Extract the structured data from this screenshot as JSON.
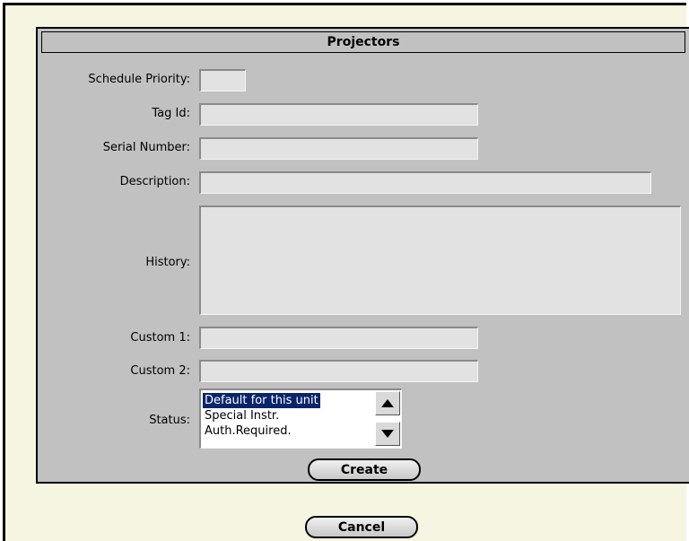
{
  "form": {
    "title": "Projectors",
    "labels": {
      "schedule_priority": "Schedule Priority:",
      "tag_id": "Tag Id:",
      "serial_number": "Serial Number:",
      "description": "Description:",
      "history": "History:",
      "custom1": "Custom 1:",
      "custom2": "Custom 2:",
      "status": "Status:"
    },
    "values": {
      "schedule_priority": "",
      "tag_id": "",
      "serial_number": "",
      "description": "",
      "history": "",
      "custom1": "",
      "custom2": ""
    },
    "status_options": [
      "Default for this unit",
      "Special Instr.",
      "Auth.Required."
    ],
    "status_selected": "Default for this unit",
    "create_label": "Create"
  },
  "footer": {
    "cancel_label": "Cancel"
  },
  "colors": {
    "page_bg": "#f5f5e1",
    "panel_bg": "#c1c1c1",
    "field_bg": "#e2e2e2",
    "selection_bg": "#0a246a"
  },
  "icons": {
    "scroll_up": "up-arrow-icon",
    "scroll_down": "down-arrow-icon"
  }
}
